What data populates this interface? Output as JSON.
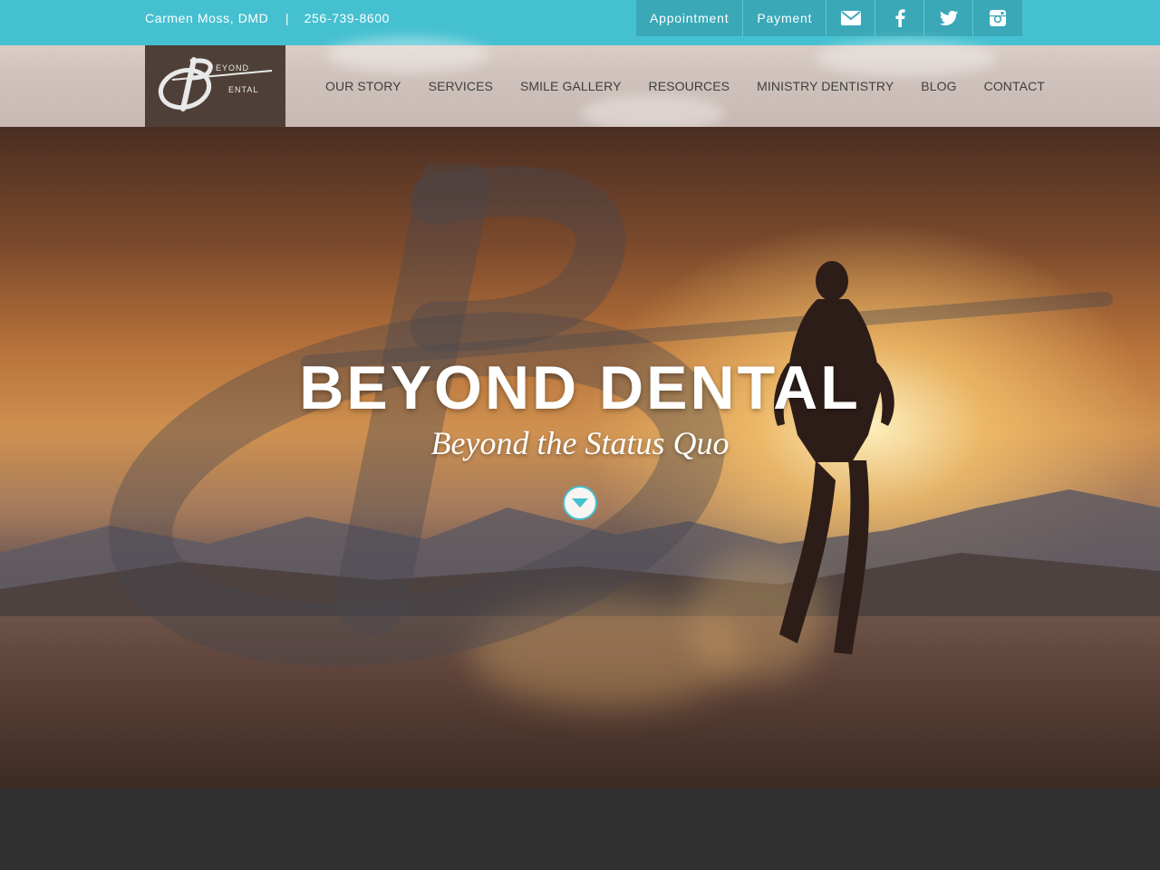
{
  "topbar": {
    "doctor": "Carmen Moss, DMD",
    "separator": "|",
    "phone": "256-739-8600",
    "appointment_label": "Appointment",
    "payment_label": "Payment",
    "icons": [
      "envelope-icon",
      "facebook-icon",
      "twitter-icon",
      "instagram-icon"
    ],
    "accent_color": "#45c0d0"
  },
  "logo": {
    "line1": "EYOND",
    "line2": "ENTAL"
  },
  "nav": {
    "items": [
      {
        "label": "OUR STORY"
      },
      {
        "label": "SERVICES"
      },
      {
        "label": "SMILE GALLERY"
      },
      {
        "label": "RESOURCES"
      },
      {
        "label": "MINISTRY DENTISTRY"
      },
      {
        "label": "BLOG"
      },
      {
        "label": "CONTACT"
      }
    ]
  },
  "hero": {
    "title": "BEYOND DENTAL",
    "subtitle": "Beyond the Status Quo",
    "scroll_icon": "chevron-down-icon"
  }
}
